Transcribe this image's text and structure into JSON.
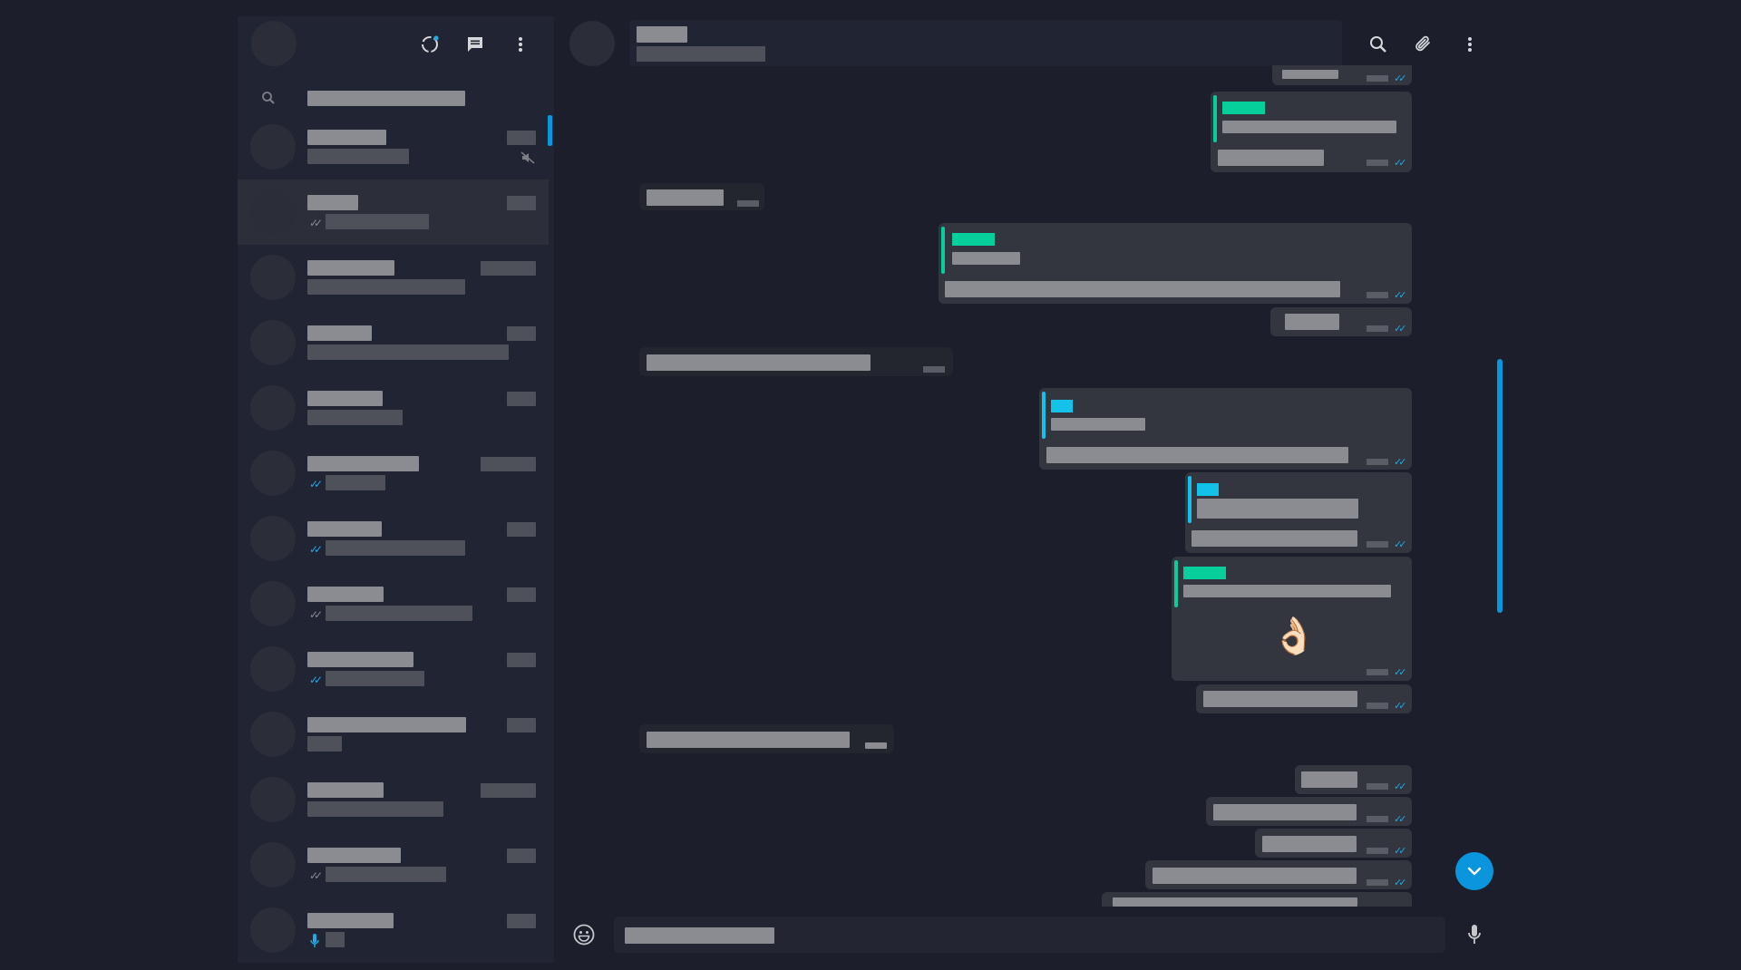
{
  "colors": {
    "background": "#1c1f2b",
    "panel": "#212432",
    "accent_blue": "#0b95dc",
    "quote_green": "#06cf9c",
    "quote_cyan": "#13c2e8",
    "placeholder_text": "#8b8b92",
    "bubble_outgoing": "#33353f",
    "bubble_incoming": "#23262f"
  },
  "sidebar": {
    "header_icons": [
      "status-icon",
      "new-chat-icon",
      "menu-icon"
    ],
    "search": {
      "icon": "search-icon",
      "placeholder": ""
    },
    "chats": [
      {
        "status": "muted"
      },
      {
        "status": "read-grey",
        "active": true
      },
      {
        "status": "none"
      },
      {
        "status": "none"
      },
      {
        "status": "none"
      },
      {
        "status": "read-blue"
      },
      {
        "status": "read-blue"
      },
      {
        "status": "read-grey"
      },
      {
        "status": "read-blue"
      },
      {
        "status": "none"
      },
      {
        "status": "none"
      },
      {
        "status": "read-grey"
      },
      {
        "status": "voice"
      }
    ]
  },
  "chat_header": {
    "icons": [
      "search-icon",
      "attach-icon",
      "menu-icon"
    ]
  },
  "messages": {
    "emoji": "👌🏻",
    "tick_glyph": "✓✓"
  },
  "composer": {
    "emoji_icon": "emoji-icon",
    "mic_icon": "microphone-icon",
    "placeholder": ""
  }
}
